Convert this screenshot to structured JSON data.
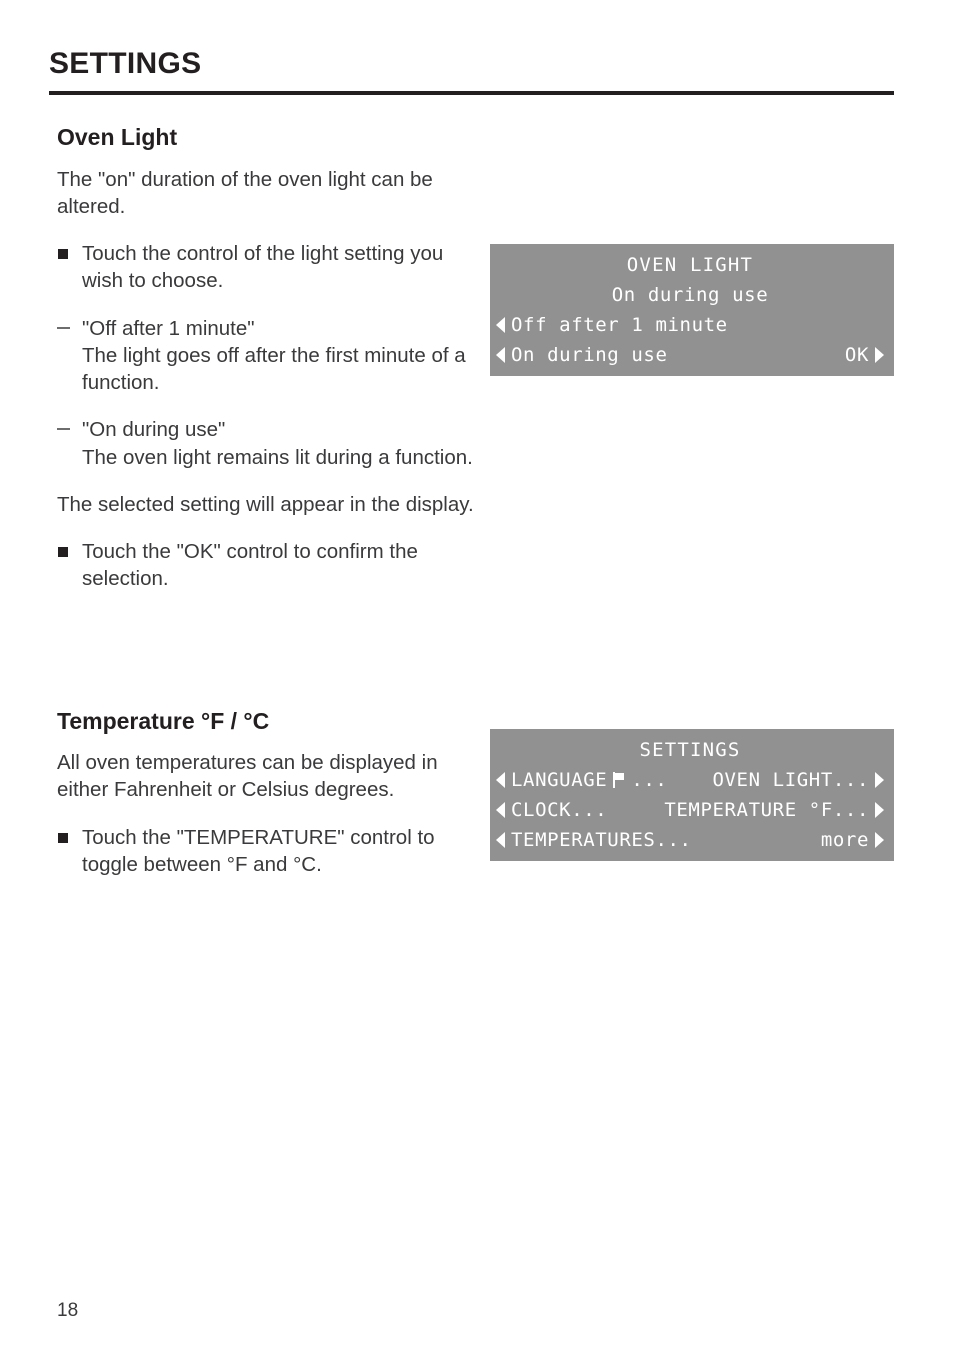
{
  "document": {
    "running_header": "SETTINGS",
    "page_number": "18"
  },
  "sections": [
    {
      "heading": "Oven Light",
      "intro": "The \"on\" duration of the oven light can be altered.",
      "bullet_1": "Touch the control of the light setting you wish to choose.",
      "dash_1": "\"Off after 1 minute\"\nThe light goes off after the first minute of a function.",
      "dash_2": "\"On during use\"\nThe oven light remains lit during a function.",
      "para_2": "The selected setting will appear in the display.",
      "bullet_2": "Touch the \"OK\" control to confirm the selection."
    },
    {
      "heading": "Temperature °F / °C",
      "intro": "All oven temperatures can be displayed in either Fahrenheit or Celsius degrees.",
      "bullet_1": "Touch the \"TEMPERATURE\" control to toggle between °F and °C."
    }
  ],
  "displays": {
    "oven_light": {
      "title": "OVEN LIGHT",
      "current_value": "On during use",
      "option_1": "Off after 1 minute",
      "option_2": "On during use",
      "confirm_label": "OK"
    },
    "settings_menu": {
      "title": "SETTINGS",
      "left_items": [
        "LANGUAGE",
        "CLOCK...",
        "TEMPERATURES..."
      ],
      "right_items": [
        "OVEN LIGHT...",
        "TEMPERATURE °F...",
        "more"
      ]
    }
  },
  "colors": {
    "lcd_background": "#919191",
    "lcd_text": "#ffffff",
    "ink": "#231f20",
    "body_text": "#3a3a3c"
  }
}
